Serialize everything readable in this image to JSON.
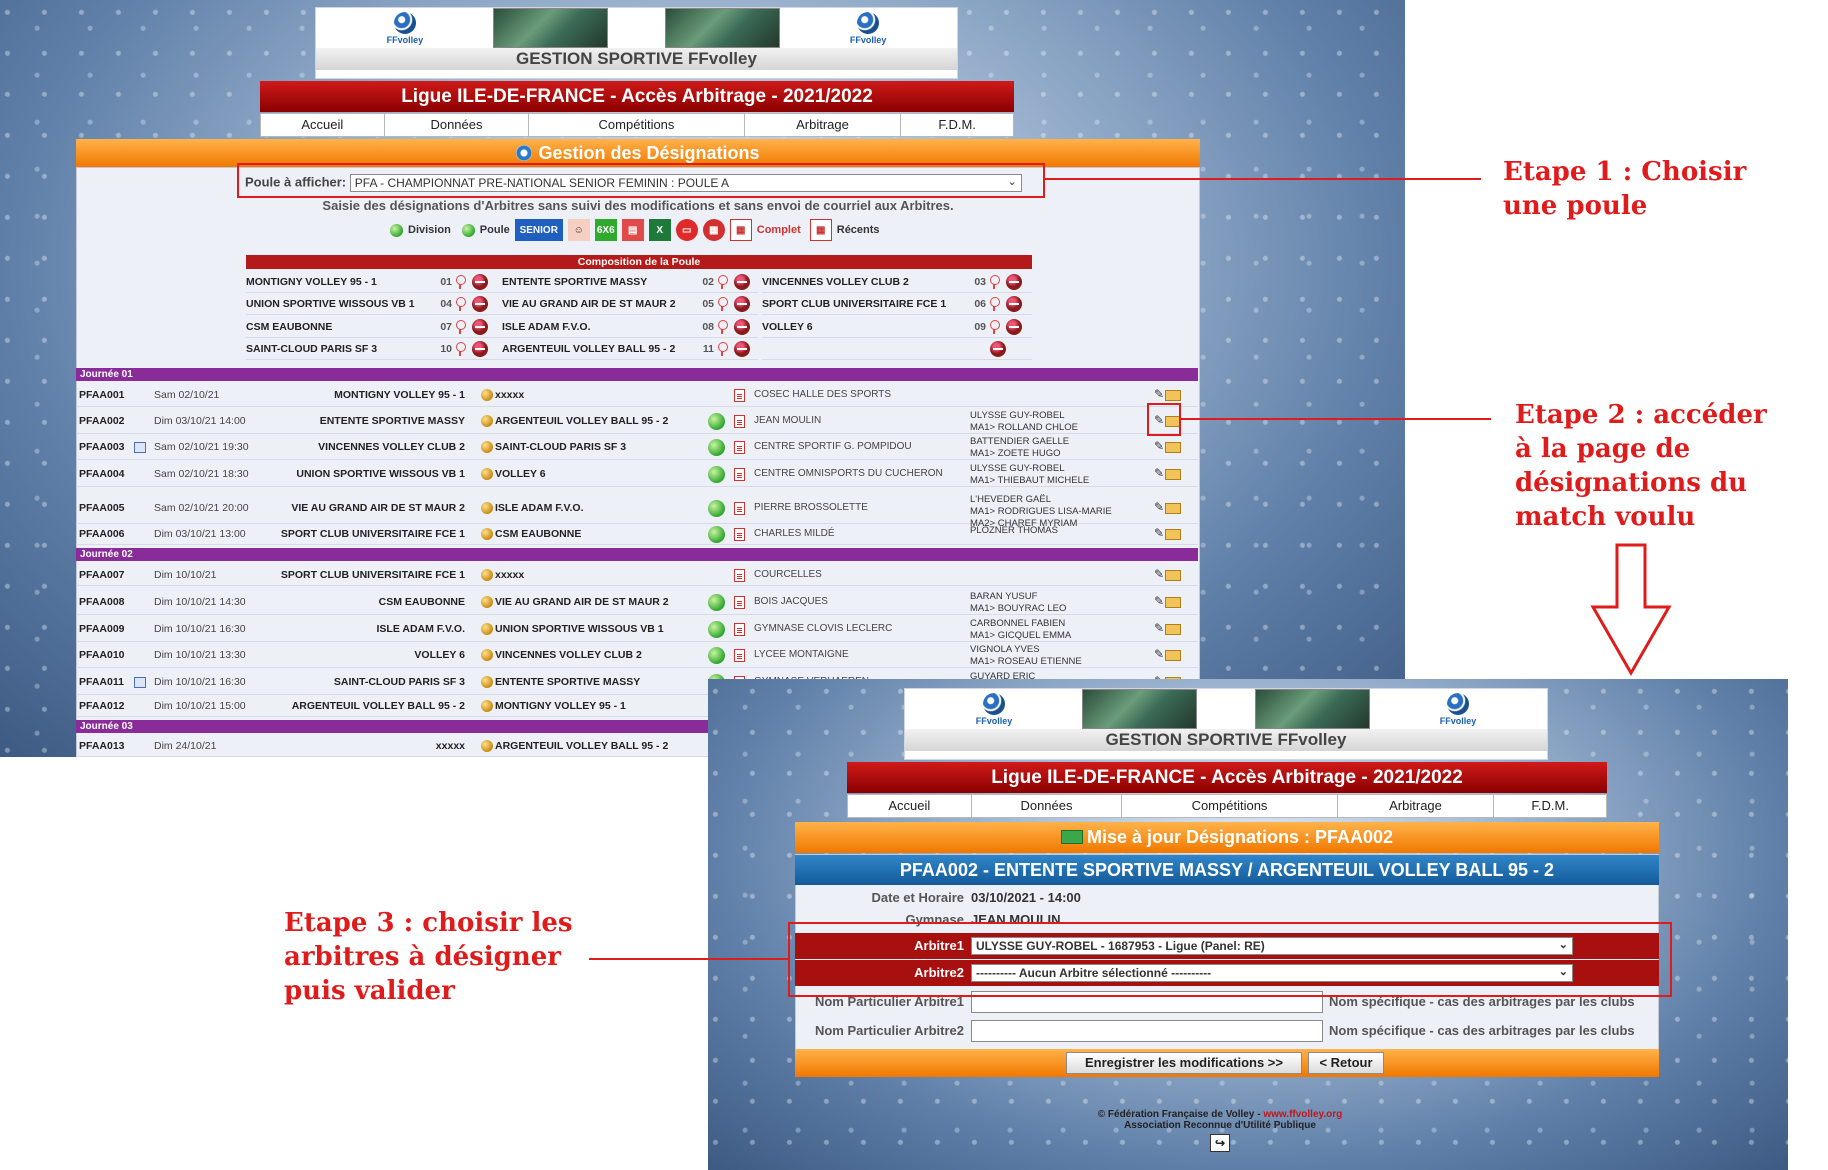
{
  "screen1": {
    "header": {
      "logo_text": "FFvolley",
      "gs_title": "GESTION SPORTIVE FFvolley",
      "ligue_title": "Ligue ILE-DE-FRANCE - Accès Arbitrage - 2021/2022"
    },
    "nav": [
      "Accueil",
      "Données",
      "Compétitions",
      "Arbitrage",
      "F.D.M."
    ],
    "panel_title": "Gestion des Désignations",
    "poule_label": "Poule à afficher:",
    "poule_value": "PFA - CHAMPIONNAT PRE-NATIONAL SENIOR FEMININ : POULE A",
    "note": "Saisie des désignations d'Arbitres sans suivi des modifications et sans envoi de courriel aux Arbitres.",
    "icons": {
      "division": "Division",
      "poule": "Poule",
      "senior": "SENIOR",
      "sixbysix": "6X6",
      "complet": "Complet",
      "recents": "Récents"
    },
    "composition_title": "Composition de la Poule",
    "composition": [
      [
        {
          "team": "MONTIGNY VOLLEY 95 - 1",
          "num": "01"
        },
        {
          "team": "ENTENTE SPORTIVE MASSY",
          "num": "02"
        },
        {
          "team": "VINCENNES VOLLEY CLUB 2",
          "num": "03"
        }
      ],
      [
        {
          "team": "UNION SPORTIVE WISSOUS VB 1",
          "num": "04"
        },
        {
          "team": "VIE AU GRAND AIR DE ST MAUR 2",
          "num": "05"
        },
        {
          "team": "SPORT CLUB UNIVERSITAIRE FCE 1",
          "num": "06"
        }
      ],
      [
        {
          "team": "CSM EAUBONNE",
          "num": "07"
        },
        {
          "team": "ISLE ADAM F.V.O.",
          "num": "08"
        },
        {
          "team": "VOLLEY 6",
          "num": "09"
        }
      ],
      [
        {
          "team": "SAINT-CLOUD PARIS SF 3",
          "num": "10"
        },
        {
          "team": "ARGENTEUIL VOLLEY BALL 95 - 2",
          "num": "11"
        },
        {
          "team": "",
          "num": ""
        }
      ]
    ],
    "days": [
      "Journée 01",
      "Journée 02",
      "Journée 03"
    ],
    "matches": [
      {
        "code": "PFAA001",
        "date": "Sam 02/10/21",
        "home": "MONTIGNY VOLLEY 95 - 1",
        "away": "xxxxx",
        "venue": "COSEC HALLE DES SPORTS",
        "refs": [
          "",
          ""
        ],
        "res": false,
        "cal": false
      },
      {
        "code": "PFAA002",
        "date": "Dim 03/10/21 14:00",
        "home": "ENTENTE SPORTIVE MASSY",
        "away": "ARGENTEUIL VOLLEY BALL 95 - 2",
        "venue": "JEAN MOULIN",
        "refs": [
          "ULYSSE GUY-ROBEL",
          "MA1> ROLLAND CHLOE"
        ],
        "res": true,
        "cal": false
      },
      {
        "code": "PFAA003",
        "date": "Sam 02/10/21 19:30",
        "home": "VINCENNES VOLLEY CLUB 2",
        "away": "SAINT-CLOUD PARIS SF 3",
        "venue": "CENTRE SPORTIF G. POMPIDOU",
        "refs": [
          "BATTENDIER GAELLE",
          "MA1> ZOETE HUGO"
        ],
        "res": true,
        "cal": true
      },
      {
        "code": "PFAA004",
        "date": "Sam 02/10/21 18:30",
        "home": "UNION SPORTIVE WISSOUS VB 1",
        "away": "VOLLEY 6",
        "venue": "CENTRE OMNISPORTS DU CUCHERON",
        "refs": [
          "ULYSSE GUY-ROBEL",
          "MA1> THIEBAUT MICHELE"
        ],
        "res": true,
        "cal": false
      },
      {
        "code": "PFAA005",
        "date": "Sam 02/10/21 20:00",
        "home": "VIE AU GRAND AIR DE ST MAUR 2",
        "away": "ISLE ADAM F.V.O.",
        "venue": "PIERRE BROSSOLETTE",
        "refs": [
          "L'HEVEDER GAËL",
          "MA1> RODRIGUES LISA-MARIE",
          "MA2> CHAREF MYRIAM"
        ],
        "res": true,
        "cal": false
      },
      {
        "code": "PFAA006",
        "date": "Dim 03/10/21 13:00",
        "home": "SPORT CLUB UNIVERSITAIRE FCE 1",
        "away": "CSM EAUBONNE",
        "venue": "CHARLES MILDÉ",
        "refs": [
          "PLOZNER THOMAS"
        ],
        "res": true,
        "cal": false
      },
      {
        "code": "PFAA007",
        "date": "Dim 10/10/21",
        "home": "SPORT CLUB UNIVERSITAIRE FCE 1",
        "away": "xxxxx",
        "venue": "COURCELLES",
        "refs": [
          ""
        ],
        "res": false,
        "cal": false
      },
      {
        "code": "PFAA008",
        "date": "Dim 10/10/21 14:30",
        "home": "CSM EAUBONNE",
        "away": "VIE AU GRAND AIR DE ST MAUR 2",
        "venue": "BOIS JACQUES",
        "refs": [
          "BARAN YUSUF",
          "MA1> BOUYRAC LEO"
        ],
        "res": true,
        "cal": false
      },
      {
        "code": "PFAA009",
        "date": "Dim 10/10/21 16:30",
        "home": "ISLE ADAM F.V.O.",
        "away": "UNION SPORTIVE WISSOUS VB 1",
        "venue": "GYMNASE CLOVIS LECLERC",
        "refs": [
          "CARBONNEL FABIEN",
          "MA1> GICQUEL EMMA"
        ],
        "res": true,
        "cal": false
      },
      {
        "code": "PFAA010",
        "date": "Dim 10/10/21 13:30",
        "home": "VOLLEY 6",
        "away": "VINCENNES VOLLEY CLUB 2",
        "venue": "LYCEE MONTAIGNE",
        "refs": [
          "VIGNOLA YVES",
          "MA1> ROSEAU ETIENNE"
        ],
        "res": true,
        "cal": false
      },
      {
        "code": "PFAA011",
        "date": "Dim 10/10/21 16:30",
        "home": "SAINT-CLOUD PARIS SF 3",
        "away": "ENTENTE SPORTIVE MASSY",
        "venue": "GYMNASE VERHAEREN",
        "refs": [
          "GUYARD ERIC"
        ],
        "res": true,
        "cal": true
      },
      {
        "code": "PFAA012",
        "date": "Dim 10/10/21 15:00",
        "home": "ARGENTEUIL VOLLEY BALL 95 - 2",
        "away": "MONTIGNY VOLLEY 95 - 1",
        "venue": "",
        "refs": [
          ""
        ],
        "res": true,
        "cal": false
      },
      {
        "code": "PFAA013",
        "date": "Dim 24/10/21",
        "home": "xxxxx",
        "away": "ARGENTEUIL VOLLEY BALL 95 - 2",
        "venue": "",
        "refs": [
          ""
        ],
        "res": false,
        "cal": false
      }
    ]
  },
  "screen2": {
    "header": {
      "logo_text": "FFvolley",
      "gs_title": "GESTION SPORTIVE FFvolley",
      "ligue_title": "Ligue ILE-DE-FRANCE - Accès Arbitrage - 2021/2022"
    },
    "nav": [
      "Accueil",
      "Données",
      "Compétitions",
      "Arbitrage",
      "F.D.M."
    ],
    "mise_title": "Mise à jour Désignations : PFAA002",
    "match_title": "PFAA002 - ENTENTE SPORTIVE MASSY / ARGENTEUIL VOLLEY BALL 95 - 2",
    "date_label": "Date et Horaire",
    "date_value": "03/10/2021 - 14:00",
    "gym_label": "Gymnase",
    "gym_value": "JEAN MOULIN",
    "arb1_label": "Arbitre1",
    "arb1_value": "ULYSSE GUY-ROBEL - 1687953 - Ligue (Panel: RE)",
    "arb2_label": "Arbitre2",
    "arb2_value": "---------- Aucun Arbitre sélectionné ----------",
    "np1_label": "Nom Particulier Arbitre1",
    "np2_label": "Nom Particulier Arbitre2",
    "np_hint": "Nom spécifique - cas des arbitrages par les clubs",
    "save_btn": "Enregistrer les modifications >>",
    "back_btn": "< Retour",
    "footer_line1": "© Fédération Française de Volley -",
    "footer_link": "www.ffvolley.org",
    "footer_line2": "Association Reconnue d'Utilité Publique"
  },
  "callouts": {
    "step1": [
      "Etape 1 : Choisir",
      "une poule"
    ],
    "step2": [
      "Etape 2 : accéder",
      "à la page de",
      "désignations du",
      "match voulu"
    ],
    "step3": [
      "Etape 3 : choisir les",
      "arbitres à désigner",
      "puis valider"
    ]
  },
  "colors": {
    "accent_red": "#e01b1b",
    "ligue_red": "#b00000",
    "orange": "#f07800",
    "blue": "#1f6fb0",
    "day_purple": "#8a2b9a"
  }
}
